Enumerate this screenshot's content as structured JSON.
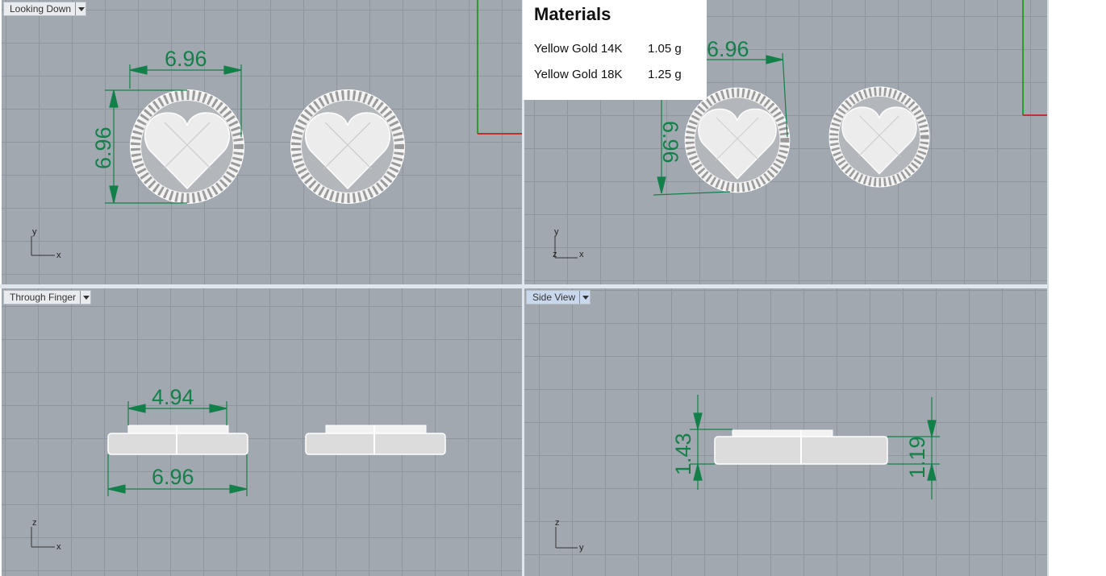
{
  "viewports": {
    "top_left": {
      "label": "Looking Down",
      "dims": {
        "width": "6.96",
        "height": "6.96"
      },
      "axes": {
        "v": "y",
        "h": "x"
      }
    },
    "top_right": {
      "dims": {
        "width": "6.96",
        "height": "6.96"
      },
      "axes": {
        "v": "y",
        "h": "x",
        "origin": "z"
      }
    },
    "bottom_left": {
      "label": "Through Finger",
      "dims": {
        "top": "4.94",
        "bottom": "6.96"
      },
      "axes": {
        "v": "z",
        "h": "x"
      }
    },
    "bottom_right": {
      "label": "Side View",
      "dims": {
        "left": "1.43",
        "right": "1.19"
      },
      "axes": {
        "v": "z",
        "h": "y"
      }
    }
  },
  "materials": {
    "title": "Materials",
    "items": [
      {
        "name": "Yellow Gold 14K",
        "weight": "1.05 g"
      },
      {
        "name": "Yellow Gold 18K",
        "weight": "1.25 g"
      }
    ]
  },
  "colors": {
    "dimension": "#13804a",
    "viewport_bg": "#a2a8b0",
    "active_label": "#c9d8ec"
  }
}
